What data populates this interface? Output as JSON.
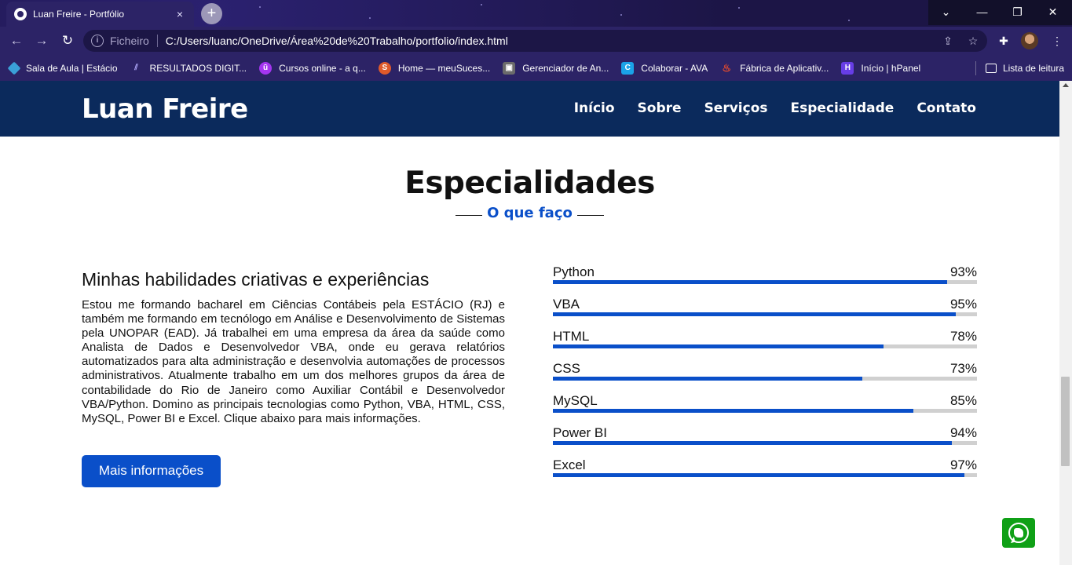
{
  "browser": {
    "tab_title": "Luan Freire - Portfólio",
    "tab_close": "×",
    "new_tab": "+",
    "window_controls": {
      "dropdown": "⌄",
      "minimize": "—",
      "restore": "❐",
      "close": "✕"
    },
    "nav": {
      "back": "←",
      "forward": "→",
      "reload": "↻"
    },
    "omnibox": {
      "info": "i",
      "scheme_label": "Ficheiro",
      "url": "C:/Users/luanc/OneDrive/Área%20de%20Trabalho/portfolio/index.html"
    },
    "bookmarks": [
      {
        "label": "Sala de Aula | Estácio",
        "icon": "estacio-icon",
        "color": "#3aa0d8"
      },
      {
        "label": "RESULTADOS DIGIT...",
        "icon": "results-icon",
        "color": "#6a5fd8"
      },
      {
        "label": "Cursos online - a q...",
        "icon": "udemy-icon",
        "color": "#a435f0"
      },
      {
        "label": "Home — meuSuces...",
        "icon": "meusucesso-icon",
        "color": "#e05a2b"
      },
      {
        "label": "Gerenciador de An...",
        "icon": "ads-manager-icon",
        "color": "#6b6b6b"
      },
      {
        "label": "Colaborar - AVA",
        "icon": "colaborar-icon",
        "color": "#1aa3e8"
      },
      {
        "label": "Fábrica de Aplicativ...",
        "icon": "fabrica-icon",
        "color": "#ef4d2a"
      },
      {
        "label": "Início | hPanel",
        "icon": "hostinger-icon",
        "color": "#673de6"
      }
    ],
    "reading_list": "Lista de leitura"
  },
  "site": {
    "brand": "Luan Freire",
    "menu": [
      "Início",
      "Sobre",
      "Serviços",
      "Especialidade",
      "Contato"
    ],
    "section_title": "Especialidades",
    "section_subtitle": "O que faço",
    "about_heading": "Minhas habilidades criativas e experiências",
    "about_text": "Estou me formando bacharel em Ciências Contábeis pela ESTÁCIO (RJ) e também me formando em tecnólogo em Análise e Desenvolvimento de Sistemas pela UNOPAR (EAD). Já trabalhei em uma empresa da área da saúde como Analista de Dados e Desenvolvedor VBA, onde eu gerava relatórios automatizados para alta administração e desenvolvia automações de processos administrativos. Atualmente trabalho em um dos melhores grupos da área de contabilidade do Rio de Janeiro como Auxiliar Contábil e Desenvolvedor VBA/Python. Domino as principais tecnologias como Python, VBA, HTML, CSS, MySQL, Power BI e Excel. Clique abaixo para mais informações.",
    "more_button": "Mais informações",
    "skills": [
      {
        "name": "Python",
        "percent": 93,
        "label": "93%"
      },
      {
        "name": "VBA",
        "percent": 95,
        "label": "95%"
      },
      {
        "name": "HTML",
        "percent": 78,
        "label": "78%"
      },
      {
        "name": "CSS",
        "percent": 73,
        "label": "73%"
      },
      {
        "name": "MySQL",
        "percent": 85,
        "label": "85%"
      },
      {
        "name": "Power BI",
        "percent": 94,
        "label": "94%"
      },
      {
        "name": "Excel",
        "percent": 97,
        "label": "97%"
      }
    ],
    "accent_color": "#0a4fc9",
    "navbar_color": "#0b2a5c",
    "whatsapp_color": "#0fa016"
  }
}
